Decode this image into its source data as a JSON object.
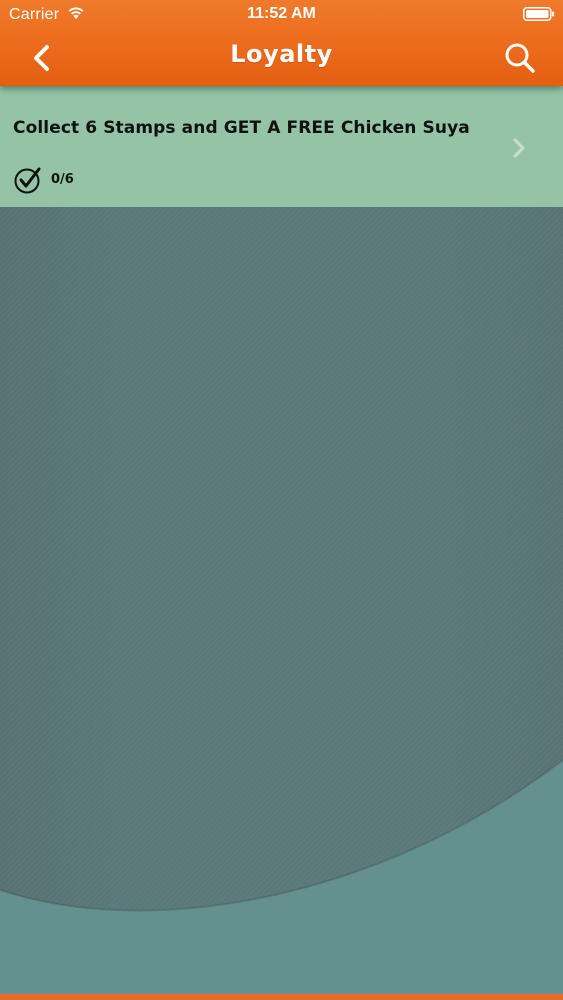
{
  "status_bar": {
    "carrier": "Carrier",
    "time": "11:52 AM",
    "wifi_icon": "wifi-icon",
    "battery_icon": "battery-icon"
  },
  "nav": {
    "title": "Loyalty",
    "back_icon": "chevron-left-icon",
    "search_icon": "search-icon"
  },
  "loyalty_items": [
    {
      "title": "Collect 6 Stamps and GET A FREE Chicken Suya",
      "progress_text": "0/6",
      "stamps_collected": 0,
      "stamps_required": 6
    }
  ],
  "colors": {
    "header_orange": "#ec6b1c",
    "row_green": "#94c3a5",
    "background_teal": "#5b7978",
    "curve_teal": "#64918f",
    "bottom_bar": "#e8692a"
  }
}
